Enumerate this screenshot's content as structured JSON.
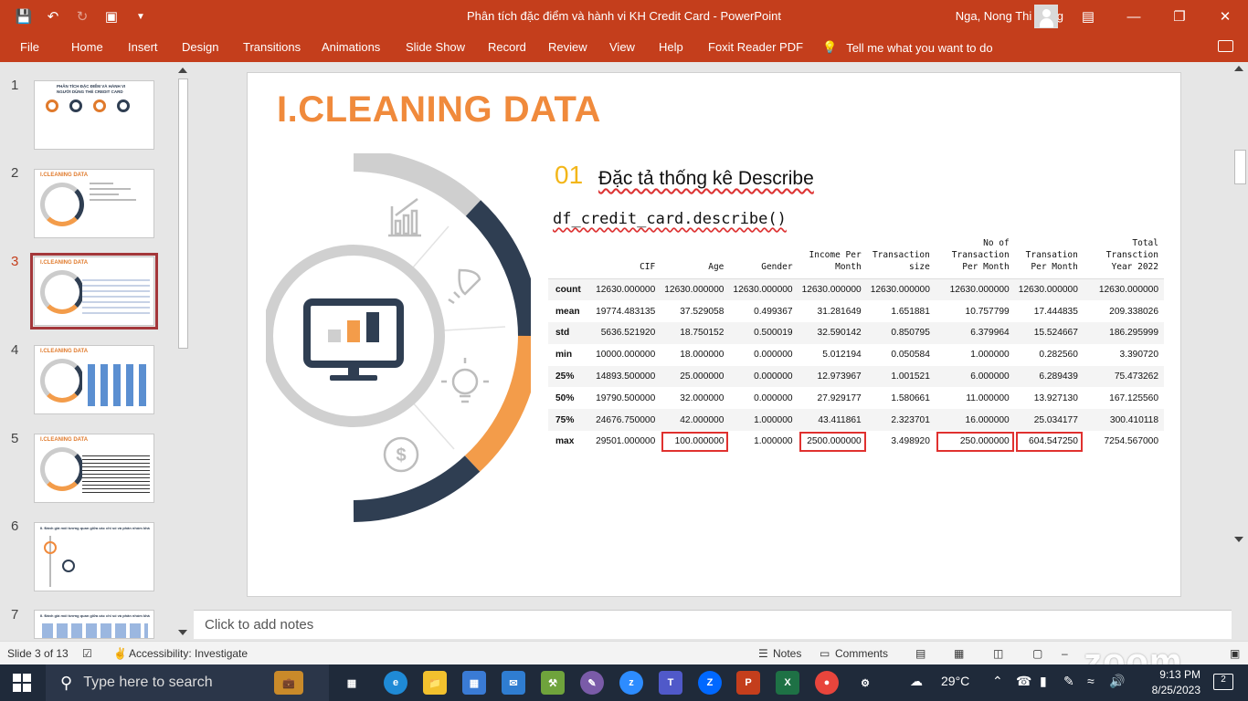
{
  "window": {
    "title": "Phân tích đặc điểm và hành vi KH Credit Card  -  PowerPoint",
    "user": "Nga, Nong Thi Hang"
  },
  "ribbon": {
    "tabs": [
      "File",
      "Home",
      "Insert",
      "Design",
      "Transitions",
      "Animations",
      "Slide Show",
      "Record",
      "Review",
      "View",
      "Help",
      "Foxit Reader PDF"
    ],
    "tell_me": "Tell me what you want to do"
  },
  "thumbnails": {
    "numbers": [
      "1",
      "2",
      "3",
      "4",
      "5",
      "6",
      "7"
    ],
    "titles": [
      "PHÂN TÍCH ĐẶC ĐIỂM VÀ HÀNH VI NGƯỜI DÙNG THẺ CREDIT CARD",
      "I.CLEANING DATA",
      "I.CLEANING DATA",
      "I.CLEANING DATA",
      "I.CLEANING DATA",
      "II. Đánh giá mối tương quan giữa các chỉ số và phân nhóm khách hàng",
      "II. Đánh giá mối tương quan giữa các chỉ số và phân nhóm khách hàng"
    ],
    "active_index": 2
  },
  "slide": {
    "title": "I.CLEANING DATA",
    "section_number": "01",
    "section_title": "Đặc tả thống kê Describe",
    "code": "df_credit_card.describe()",
    "table": {
      "columns": [
        "CIF",
        "Age",
        "Gender",
        "Income Per Month",
        "Transaction size",
        "No of Transaction Per Month",
        "Transation Per Month",
        "Total Transction Year 2022"
      ],
      "rows": [
        {
          "label": "count",
          "values": [
            "12630.000000",
            "12630.000000",
            "12630.000000",
            "12630.000000",
            "12630.000000",
            "12630.000000",
            "12630.000000",
            "12630.000000"
          ]
        },
        {
          "label": "mean",
          "values": [
            "19774.483135",
            "37.529058",
            "0.499367",
            "31.281649",
            "1.651881",
            "10.757799",
            "17.444835",
            "209.338026"
          ]
        },
        {
          "label": "std",
          "values": [
            "5636.521920",
            "18.750152",
            "0.500019",
            "32.590142",
            "0.850795",
            "6.379964",
            "15.524667",
            "186.295999"
          ]
        },
        {
          "label": "min",
          "values": [
            "10000.000000",
            "18.000000",
            "0.000000",
            "5.012194",
            "0.050584",
            "1.000000",
            "0.282560",
            "3.390720"
          ]
        },
        {
          "label": "25%",
          "values": [
            "14893.500000",
            "25.000000",
            "0.000000",
            "12.973967",
            "1.001521",
            "6.000000",
            "6.289439",
            "75.473262"
          ]
        },
        {
          "label": "50%",
          "values": [
            "19790.500000",
            "32.000000",
            "0.000000",
            "27.929177",
            "1.580661",
            "11.000000",
            "13.927130",
            "167.125560"
          ]
        },
        {
          "label": "75%",
          "values": [
            "24676.750000",
            "42.000000",
            "1.000000",
            "43.411861",
            "2.323701",
            "16.000000",
            "25.034177",
            "300.410118"
          ]
        },
        {
          "label": "max",
          "values": [
            "29501.000000",
            "100.000000",
            "1.000000",
            "2500.000000",
            "3.498920",
            "250.000000",
            "604.547250",
            "7254.567000"
          ]
        }
      ],
      "highlighted_max_columns": [
        1,
        3,
        5,
        6
      ]
    }
  },
  "notes": {
    "placeholder": "Click to add notes"
  },
  "status": {
    "slide_counter": "Slide 3 of 13",
    "accessibility": "Accessibility: Investigate",
    "notes_btn": "Notes",
    "comments_btn": "Comments",
    "zoom_logo": "zoom"
  },
  "taskbar": {
    "search_placeholder": "Type here to search",
    "weather": "29°C",
    "time": "9:13 PM",
    "date": "8/25/2023",
    "notifications": "2"
  },
  "colors": {
    "ribbon": "#c43e1c",
    "title_orange": "#f08a3c",
    "navy": "#2f3e52",
    "highlight_red": "#e0312f"
  }
}
